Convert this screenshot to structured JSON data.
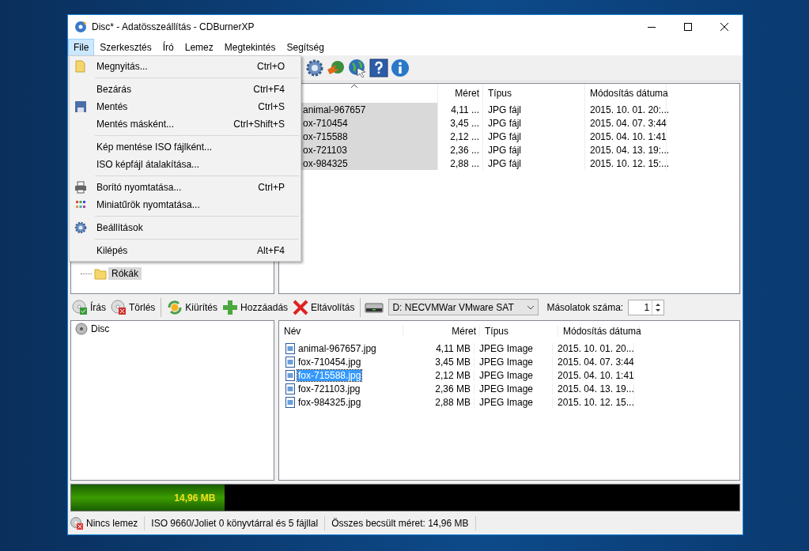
{
  "window": {
    "title": "Disc* - Adatösszeállítás - CDBurnerXP"
  },
  "menubar": [
    {
      "label": "File",
      "selected": true
    },
    {
      "label": "Szerkesztés",
      "selected": false
    },
    {
      "label": "Író",
      "selected": false
    },
    {
      "label": "Lemez",
      "selected": false
    },
    {
      "label": "Megtekintés",
      "selected": false
    },
    {
      "label": "Segítség",
      "selected": false
    }
  ],
  "file_menu": [
    {
      "kind": "item",
      "label": "Megnyitás...",
      "shortcut": "Ctrl+O"
    },
    {
      "kind": "separator"
    },
    {
      "kind": "item",
      "label": "Bezárás",
      "shortcut": "Ctrl+F4"
    },
    {
      "kind": "item",
      "label": "Mentés",
      "shortcut": "Ctrl+S"
    },
    {
      "kind": "item",
      "label": "Mentés másként...",
      "shortcut": "Ctrl+Shift+S"
    },
    {
      "kind": "separator"
    },
    {
      "kind": "item",
      "label": "Kép mentése ISO fájlként..."
    },
    {
      "kind": "item",
      "label": "ISO képfájl átalakítása..."
    },
    {
      "kind": "separator"
    },
    {
      "kind": "item",
      "label": "Borító nyomtatása...",
      "shortcut": "Ctrl+P"
    },
    {
      "kind": "item",
      "label": "Miniatűrök nyomtatása..."
    },
    {
      "kind": "separator"
    },
    {
      "kind": "item",
      "label": "Beállítások"
    },
    {
      "kind": "separator"
    },
    {
      "kind": "item",
      "label": "Kilépés",
      "shortcut": "Alt+F4"
    }
  ],
  "top_tree": {
    "items": [
      {
        "label": "Rókák",
        "selected": true
      }
    ]
  },
  "top_list": {
    "columns": [
      "Méret",
      "Típus",
      "Módosítás dátuma"
    ],
    "rows": [
      {
        "name": "animal-967657",
        "size": "4,11 ...",
        "type": "JPG fájl",
        "modified": "2015. 10. 01. 20:...",
        "selected": true
      },
      {
        "name": "ox-710454",
        "size": "3,45 ...",
        "type": "JPG fájl",
        "modified": "2015. 04. 07. 3:44",
        "selected": true
      },
      {
        "name": "ox-715588",
        "size": "2,12 ...",
        "type": "JPG fájl",
        "modified": "2015. 04. 10. 1:41",
        "selected": true
      },
      {
        "name": "ox-721103",
        "size": "2,36 ...",
        "type": "JPG fájl",
        "modified": "2015. 04. 13. 19:...",
        "selected": true
      },
      {
        "name": "ox-984325",
        "size": "2,88 ...",
        "type": "JPG fájl",
        "modified": "2015. 10. 12. 15:...",
        "selected": true
      }
    ]
  },
  "bottom_toolbar": {
    "buttons": [
      "Írás",
      "Törlés",
      "Kiürítés",
      "Hozzáadás",
      "Eltávolítás"
    ],
    "drive": "D: NECVMWar VMware SAT",
    "copies_label": "Másolatok száma:",
    "copies": "1"
  },
  "bottom_tree": {
    "items": [
      {
        "label": "Disc"
      }
    ]
  },
  "bottom_list": {
    "columns": [
      "Név",
      "Méret",
      "Típus",
      "Módosítás dátuma"
    ],
    "rows": [
      {
        "name": "animal-967657.jpg",
        "size": "4,11 MB",
        "type": "JPEG Image",
        "modified": "2015. 10. 01. 20...",
        "selected": false
      },
      {
        "name": "fox-710454.jpg",
        "size": "3,45 MB",
        "type": "JPEG Image",
        "modified": "2015. 04. 07. 3:44",
        "selected": false
      },
      {
        "name": "fox-715588.jpg",
        "size": "2,12 MB",
        "type": "JPEG Image",
        "modified": "2015. 04. 10. 1:41",
        "selected": true
      },
      {
        "name": "fox-721103.jpg",
        "size": "2,36 MB",
        "type": "JPEG Image",
        "modified": "2015. 04. 13. 19...",
        "selected": false
      },
      {
        "name": "fox-984325.jpg",
        "size": "2,88 MB",
        "type": "JPEG Image",
        "modified": "2015. 10. 12. 15...",
        "selected": false
      }
    ]
  },
  "capacity": {
    "label": "14,96 MB",
    "level": 0.23
  },
  "status_bar": [
    "Nincs lemez",
    "ISO 9660/Joliet 0 könyvtárral és 5 fájllal",
    "Összes becsült méret: 14,96 MB"
  ]
}
